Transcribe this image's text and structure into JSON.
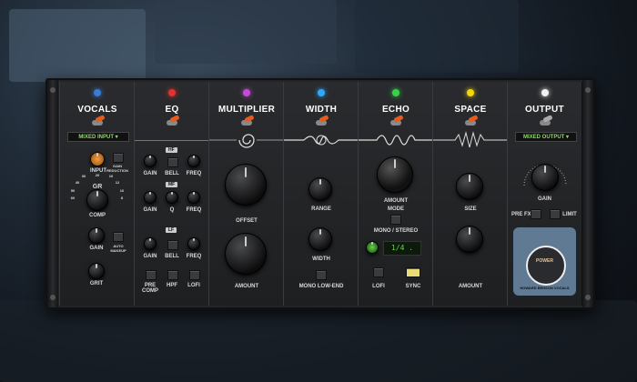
{
  "colors": {
    "vocals": "#3a7bd5",
    "eq": "#e0322f",
    "multiplier": "#c44bd6",
    "width": "#2fa8ff",
    "echo": "#39d14a",
    "space": "#f4d60a",
    "output": "#f2f2f2"
  },
  "modules": {
    "vocals": {
      "title": "VOCALS",
      "meter": "MIXED INPUT ▾",
      "input": "INPUT",
      "gain_reduction": "GAIN REDUCTION",
      "gr": "GR",
      "scale": [
        "60",
        "50",
        "40",
        "30",
        "20",
        "16",
        "12",
        "10",
        "8"
      ],
      "comp": "COMP",
      "gain": "GAIN",
      "auto": "AUTO MAKEUP",
      "grit": "GRIT"
    },
    "eq": {
      "title": "EQ",
      "hf": "HF",
      "mf": "MF",
      "lf": "LF",
      "gain": "GAIN",
      "bell": "BELL",
      "freq": "FREQ",
      "q": "Q",
      "pre_comp": "PRE COMP",
      "hpf": "HPF",
      "lofi": "LOFI"
    },
    "multiplier": {
      "title": "MULTIPLIER",
      "offset": "OFFSET",
      "amount": "AMOUNT"
    },
    "width": {
      "title": "WIDTH",
      "range": "RANGE",
      "width": "WIDTH",
      "mono_low_end": "MONO LOW-END"
    },
    "echo": {
      "title": "ECHO",
      "amount": "AMOUNT",
      "mode": "MODE",
      "mono_stereo": "MONO / STEREO",
      "sync_value": "1/4 .",
      "lofi": "LOFI",
      "sync": "SYNC"
    },
    "space": {
      "title": "SPACE",
      "size": "SIZE",
      "amount": "AMOUNT"
    },
    "output": {
      "title": "OUTPUT",
      "meter": "MIXED OUTPUT ▾",
      "gain": "GAIN",
      "pre_fx": "PRE FX",
      "limit": "LIMIT",
      "badge_power": "POWER",
      "badge_name": "HOWARD BENSON VOCALS"
    }
  }
}
